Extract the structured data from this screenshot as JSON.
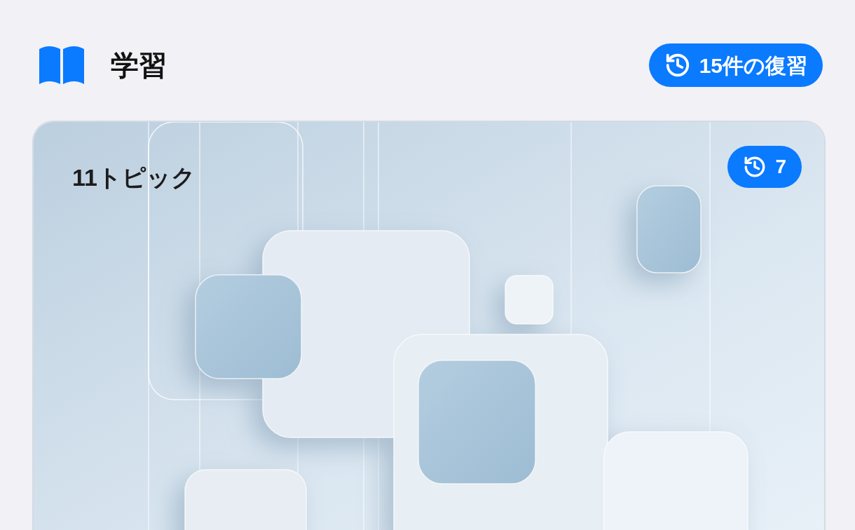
{
  "header": {
    "title": "学習",
    "review_button": {
      "label": "15件の復習"
    }
  },
  "card": {
    "topic_count": "11トピック",
    "review_badge": {
      "label": "7"
    }
  }
}
